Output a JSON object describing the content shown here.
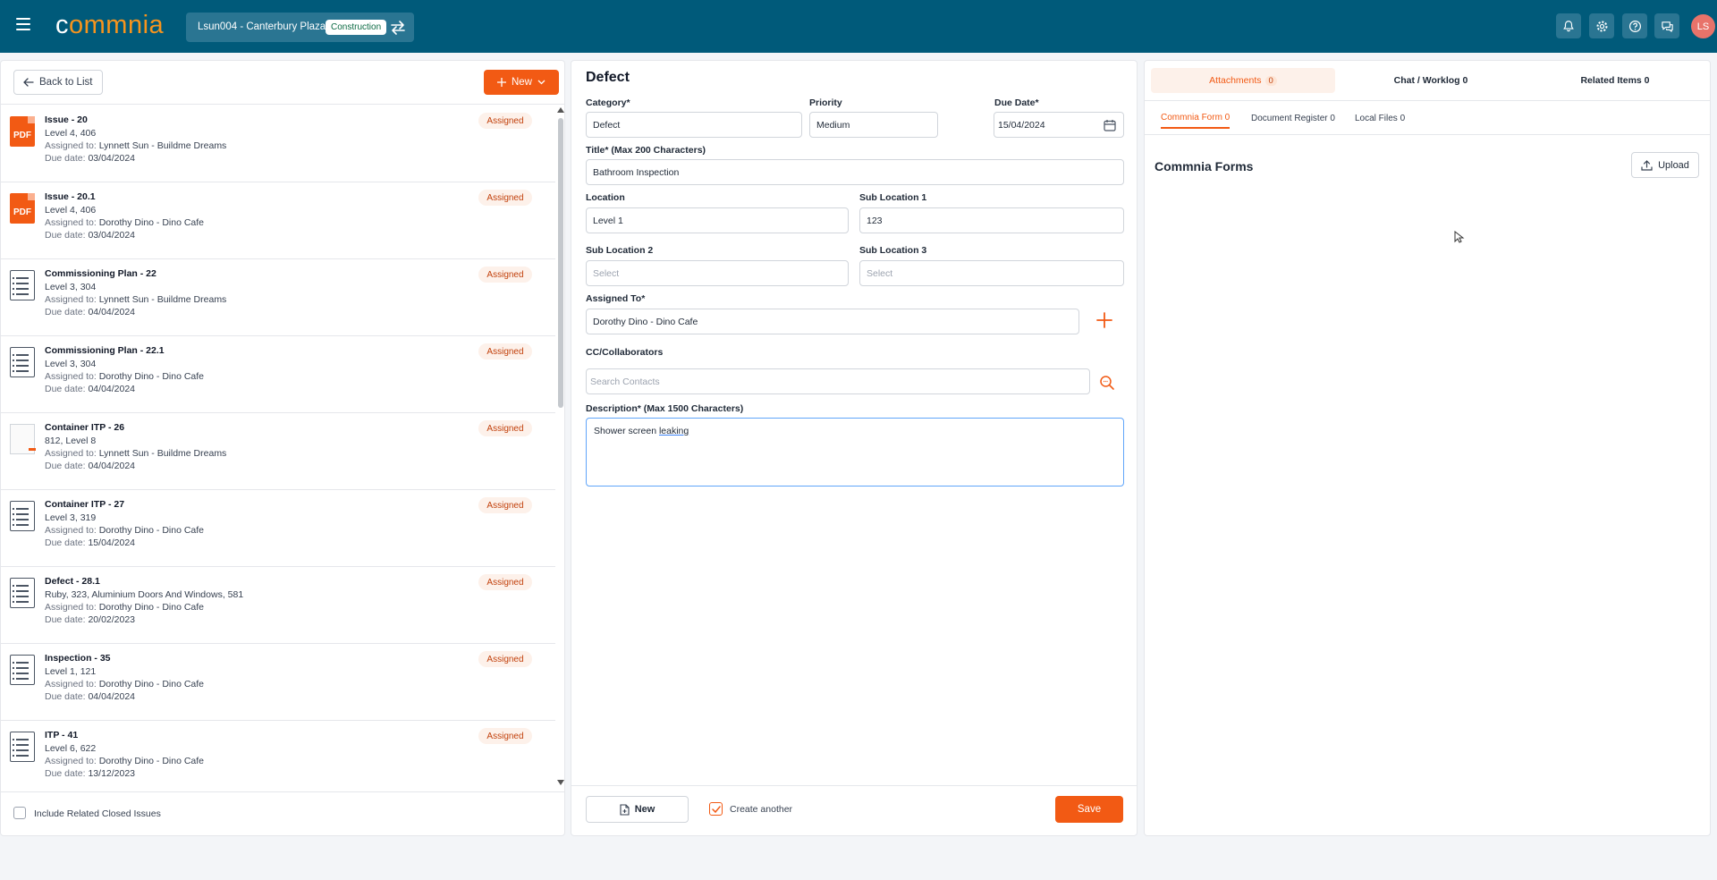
{
  "header": {
    "logo": {
      "c": "c",
      "o": "o",
      "rest": "mmnia"
    },
    "project_name": "Lsun004 - Canterbury Plaza",
    "project_badge": "Construction",
    "avatar_initials": "LS",
    "icons": [
      "bell-icon",
      "gear-icon",
      "help-icon",
      "chat-icon"
    ]
  },
  "left": {
    "back_label": "Back to List",
    "new_label": "New",
    "assigned_key": "Assigned to:",
    "due_key": "Due date:",
    "items": [
      {
        "icon": "pdf",
        "title": "Issue - 20",
        "location": "Level 4, 406",
        "assigned": "Lynnett Sun - Buildme Dreams",
        "due": "03/04/2024",
        "status": "Assigned"
      },
      {
        "icon": "pdf",
        "title": "Issue - 20.1",
        "location": "Level 4, 406",
        "assigned": "Dorothy Dino - Dino Cafe",
        "due": "03/04/2024",
        "status": "Assigned"
      },
      {
        "icon": "list",
        "title": "Commissioning Plan - 22",
        "location": "Level 3, 304",
        "assigned": "Lynnett Sun - Buildme Dreams",
        "due": "04/04/2024",
        "status": "Assigned"
      },
      {
        "icon": "list",
        "title": "Commissioning Plan - 22.1",
        "location": "Level 3, 304",
        "assigned": "Dorothy Dino - Dino Cafe",
        "due": "04/04/2024",
        "status": "Assigned"
      },
      {
        "icon": "thumb",
        "title": "Container ITP - 26",
        "location": "812, Level 8",
        "assigned": "Lynnett Sun - Buildme Dreams",
        "due": "04/04/2024",
        "status": "Assigned"
      },
      {
        "icon": "list",
        "title": "Container ITP - 27",
        "location": "Level 3, 319",
        "assigned": "Dorothy Dino - Dino Cafe",
        "due": "15/04/2024",
        "status": "Assigned"
      },
      {
        "icon": "list",
        "title": "Defect - 28.1",
        "location": "Ruby, 323, Aluminium Doors And Windows, 581",
        "assigned": "Dorothy Dino - Dino Cafe",
        "due": "20/02/2023",
        "status": "Assigned"
      },
      {
        "icon": "list",
        "title": "Inspection - 35",
        "location": "Level 1, 121",
        "assigned": "Dorothy Dino - Dino Cafe",
        "due": "04/04/2024",
        "status": "Assigned"
      },
      {
        "icon": "list",
        "title": "ITP - 41",
        "location": "Level 6, 622",
        "assigned": "Dorothy Dino - Dino Cafe",
        "due": "13/12/2023",
        "status": "Assigned"
      }
    ],
    "include_closed_label": "Include Related Closed Issues"
  },
  "form": {
    "title": "Defect",
    "category_label": "Category*",
    "category_value": "Defect",
    "priority_label": "Priority",
    "priority_value": "Medium",
    "due_label": "Due Date*",
    "due_value": "15/04/2024",
    "title_label": "Title* (Max 200 Characters)",
    "title_value": "Bathroom Inspection",
    "location_label": "Location",
    "location_value": "Level 1",
    "sub1_label": "Sub Location 1",
    "sub1_value": "123",
    "sub2_label": "Sub Location 2",
    "sub2_placeholder": "Select",
    "sub3_label": "Sub Location 3",
    "sub3_placeholder": "Select",
    "assigned_label": "Assigned To*",
    "assigned_value": "Dorothy Dino - Dino Cafe",
    "cc_label": "CC/Collaborators",
    "cc_placeholder": "Search Contacts",
    "desc_label": "Description* (Max 1500 Characters)",
    "desc_plain": "Shower screen ",
    "desc_underlined": "leaking",
    "new_label": "New",
    "create_another_label": "Create another",
    "save_label": "Save"
  },
  "right": {
    "tabs": [
      {
        "label": "Attachments",
        "count": "0"
      },
      {
        "label": "Chat / Worklog 0"
      },
      {
        "label": "Related Items 0"
      }
    ],
    "subtabs": [
      "Commnia Form 0",
      "Document Register 0",
      "Local Files 0"
    ],
    "forms_title": "Commnia Forms",
    "upload_label": "Upload"
  },
  "colors": {
    "header_bg": "#005a7a",
    "accent": "#f25a14",
    "badge_bg": "#fdf1ea"
  }
}
